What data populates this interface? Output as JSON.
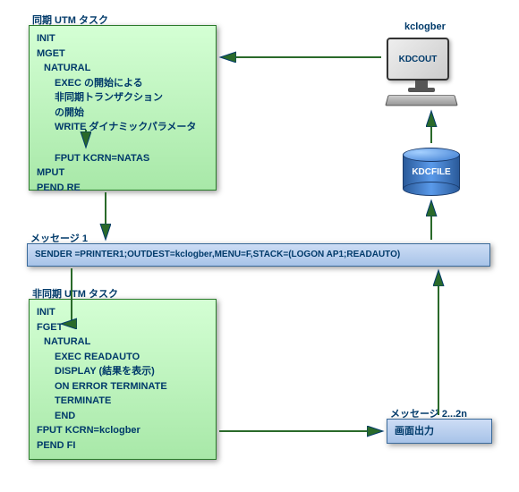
{
  "terminal": {
    "label": "kclogber",
    "screen": "KDCOUT"
  },
  "cylinder": {
    "label": "KDCFILE"
  },
  "sync": {
    "title": "同期 UTM タスク",
    "l1": "INIT",
    "l2": "MGET",
    "l3": "NATURAL",
    "l4": "EXEC の開始による",
    "l5": "非同期トランザクション",
    "l6": "の開始",
    "l7": "WRITE ダイナミックパラメータ",
    "l8": "FPUT KCRN=NATAS",
    "l9": "MPUT",
    "l10": "PEND RE"
  },
  "msg1": {
    "title": "メッセージ 1",
    "text": "SENDER =PRINTER1;OUTDEST=kclogber,MENU=F,STACK=(LOGON AP1;READAUTO)"
  },
  "async": {
    "title": "非同期 UTM タスク",
    "l1": "INIT",
    "l2": "FGET",
    "l3": "NATURAL",
    "l4": "EXEC READAUTO",
    "l5": "DISPLAY (結果を表示)",
    "l6": "ON ERROR TERMINATE",
    "l7": "TERMINATE",
    "l8": "END",
    "l9": "FPUT KCRN=kclogber",
    "l10": "PEND FI"
  },
  "msg2": {
    "title": "メッセージ 2...2n",
    "text": "画面出力"
  }
}
